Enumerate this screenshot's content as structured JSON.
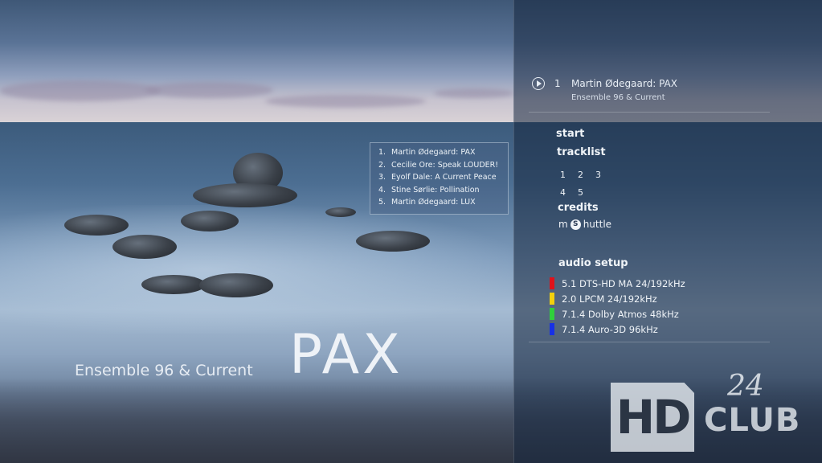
{
  "now_playing": {
    "track_number": "1",
    "title": "Martin Ødegaard: PAX",
    "artist": "Ensemble 96 & Current"
  },
  "menu": {
    "start_label": "start",
    "tracklist_label": "tracklist",
    "track_numbers": [
      "1",
      "2",
      "3",
      "4",
      "5"
    ],
    "credits_label": "credits",
    "mshuttle_prefix": "m",
    "mshuttle_icon_letter": "S",
    "mshuttle_suffix": "huttle",
    "audio_setup_label": "audio setup",
    "audio_options": [
      {
        "label": "5.1 DTS-HD MA 24/192kHz",
        "color": "#e0121b"
      },
      {
        "label": "2.0 LPCM 24/192kHz",
        "color": "#f2d10c"
      },
      {
        "label": "7.1.4 Dolby Atmos 48kHz",
        "color": "#2fd03b"
      },
      {
        "label": "7.1.4 Auro-3D 96kHz",
        "color": "#1730e6"
      }
    ]
  },
  "tracklist_popup": [
    {
      "num": "1.",
      "title": "Martin Ødegaard: PAX"
    },
    {
      "num": "2.",
      "title": "Cecilie Ore: Speak LOUDER!"
    },
    {
      "num": "3.",
      "title": "Eyolf Dale: A Current Peace"
    },
    {
      "num": "4.",
      "title": "Stine Sørlie: Pollination"
    },
    {
      "num": "5.",
      "title": "Martin Ødegaard: LUX"
    }
  ],
  "cover": {
    "artist": "Ensemble 96 & Current",
    "album": "PAX"
  },
  "logo": {
    "hd": "HD",
    "club": "CLUB",
    "number": "24"
  },
  "colors": {
    "panel": "#16263e",
    "text": "#e8eef5"
  }
}
